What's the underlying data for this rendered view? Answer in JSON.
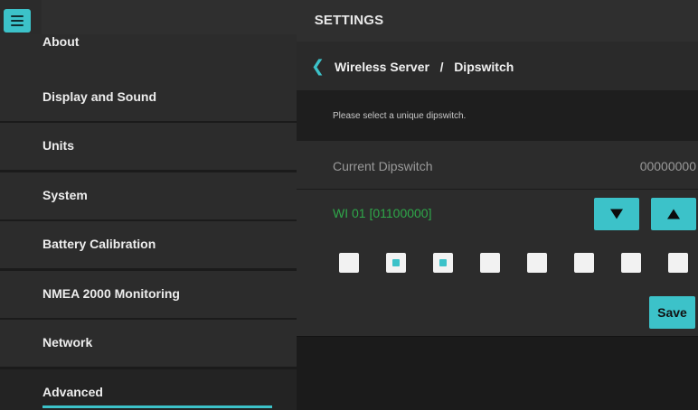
{
  "header": {
    "title": "SETTINGS",
    "menu_icon": "hamburger-icon"
  },
  "sidebar": {
    "items": [
      {
        "label": "About"
      },
      {
        "label": "Display and Sound"
      },
      {
        "label": "Units"
      },
      {
        "label": "System"
      },
      {
        "label": "Battery Calibration"
      },
      {
        "label": "NMEA 2000 Monitoring"
      },
      {
        "label": "Network"
      },
      {
        "label": "Advanced"
      }
    ],
    "active": "Advanced"
  },
  "content": {
    "breadcrumb": {
      "parent": "Wireless Server",
      "separator": "/",
      "current": "Dipswitch",
      "back_icon": "chevron-left-icon"
    },
    "hint": "Please select a unique dipswitch.",
    "current_dipswitch": {
      "label": "Current Dipswitch",
      "value": "00000000"
    },
    "selection": {
      "label": "WI 01 [01100000]"
    },
    "switches": [
      0,
      1,
      1,
      0,
      0,
      0,
      0,
      0
    ],
    "buttons": {
      "down_icon": "triangle-down-icon",
      "up_icon": "triangle-up-icon",
      "save_label": "Save"
    }
  },
  "colors": {
    "accent": "#3cc2c9",
    "selection_text": "#2fa84a",
    "background": "#1b1b1b",
    "panel": "#2c2c2c"
  }
}
